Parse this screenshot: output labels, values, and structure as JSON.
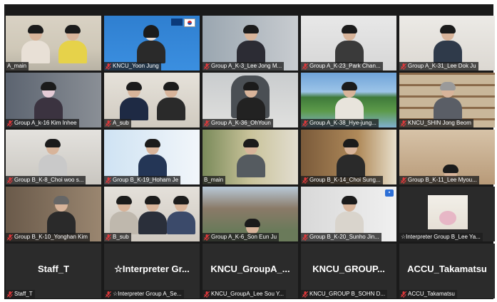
{
  "colors": {
    "grid_bg": "#1a1a1a",
    "tile_bg": "#2b2b2b",
    "active_border": "#c9d92a",
    "muted_mic": "#e0383b",
    "nameplate_text": "#ffffff"
  },
  "participants": [
    {
      "label": "A_main",
      "muted": false
    },
    {
      "label": "KNCU_Yoon Jung",
      "muted": true
    },
    {
      "label": "Group A_K-3_Lee Jong M...",
      "muted": true
    },
    {
      "label": "Group A_K-23_Park Chan...",
      "muted": true
    },
    {
      "label": "Group A_K-31_Lee Dok Ju",
      "muted": true
    },
    {
      "label": "Group A_k-16 Kim Inhee",
      "muted": true
    },
    {
      "label": "A_sub",
      "muted": true
    },
    {
      "label": "Group A_K-36_OhYoun",
      "muted": true
    },
    {
      "label": "Group A_K-38_Hye-jung...",
      "muted": true
    },
    {
      "label": "KNCU_SHIN Jong Beom",
      "muted": true
    },
    {
      "label": "Group B_K-8_Choi woo s...",
      "muted": true
    },
    {
      "label": "Group B_K-19_Hoham Je",
      "muted": true
    },
    {
      "label": "B_main",
      "muted": false
    },
    {
      "label": "Group B_K-14_Choi Sung...",
      "muted": true
    },
    {
      "label": "Group B_K-11_Lee Myou...",
      "muted": true
    },
    {
      "label": "Group B_K-10_Yonghan Kim",
      "muted": true
    },
    {
      "label": "B_sub",
      "muted": true
    },
    {
      "label": "Group A_K-6_Son Eun Ju",
      "muted": true
    },
    {
      "label": "Group B_K-20_Sunho Jin...",
      "muted": true
    },
    {
      "label": "☆Interpreter Group B_Lee Ya...",
      "muted": false
    },
    {
      "label": "Staff_T",
      "muted": true,
      "display_name": "Staff_T"
    },
    {
      "label": "☆Interpreter Group A_Se...",
      "muted": true,
      "display_name": "☆Interpreter Gr..."
    },
    {
      "label": "KNCU_GroupA_Lee Sou Y...",
      "muted": true,
      "display_name": "KNCU_GroupA_..."
    },
    {
      "label": "KNCU_GROUP B_SOHN D...",
      "muted": true,
      "display_name": "KNCU_GROUP..."
    },
    {
      "label": "ACCU_Takamatsu",
      "muted": true,
      "display_name": "ACCU_Takamatsu"
    }
  ]
}
